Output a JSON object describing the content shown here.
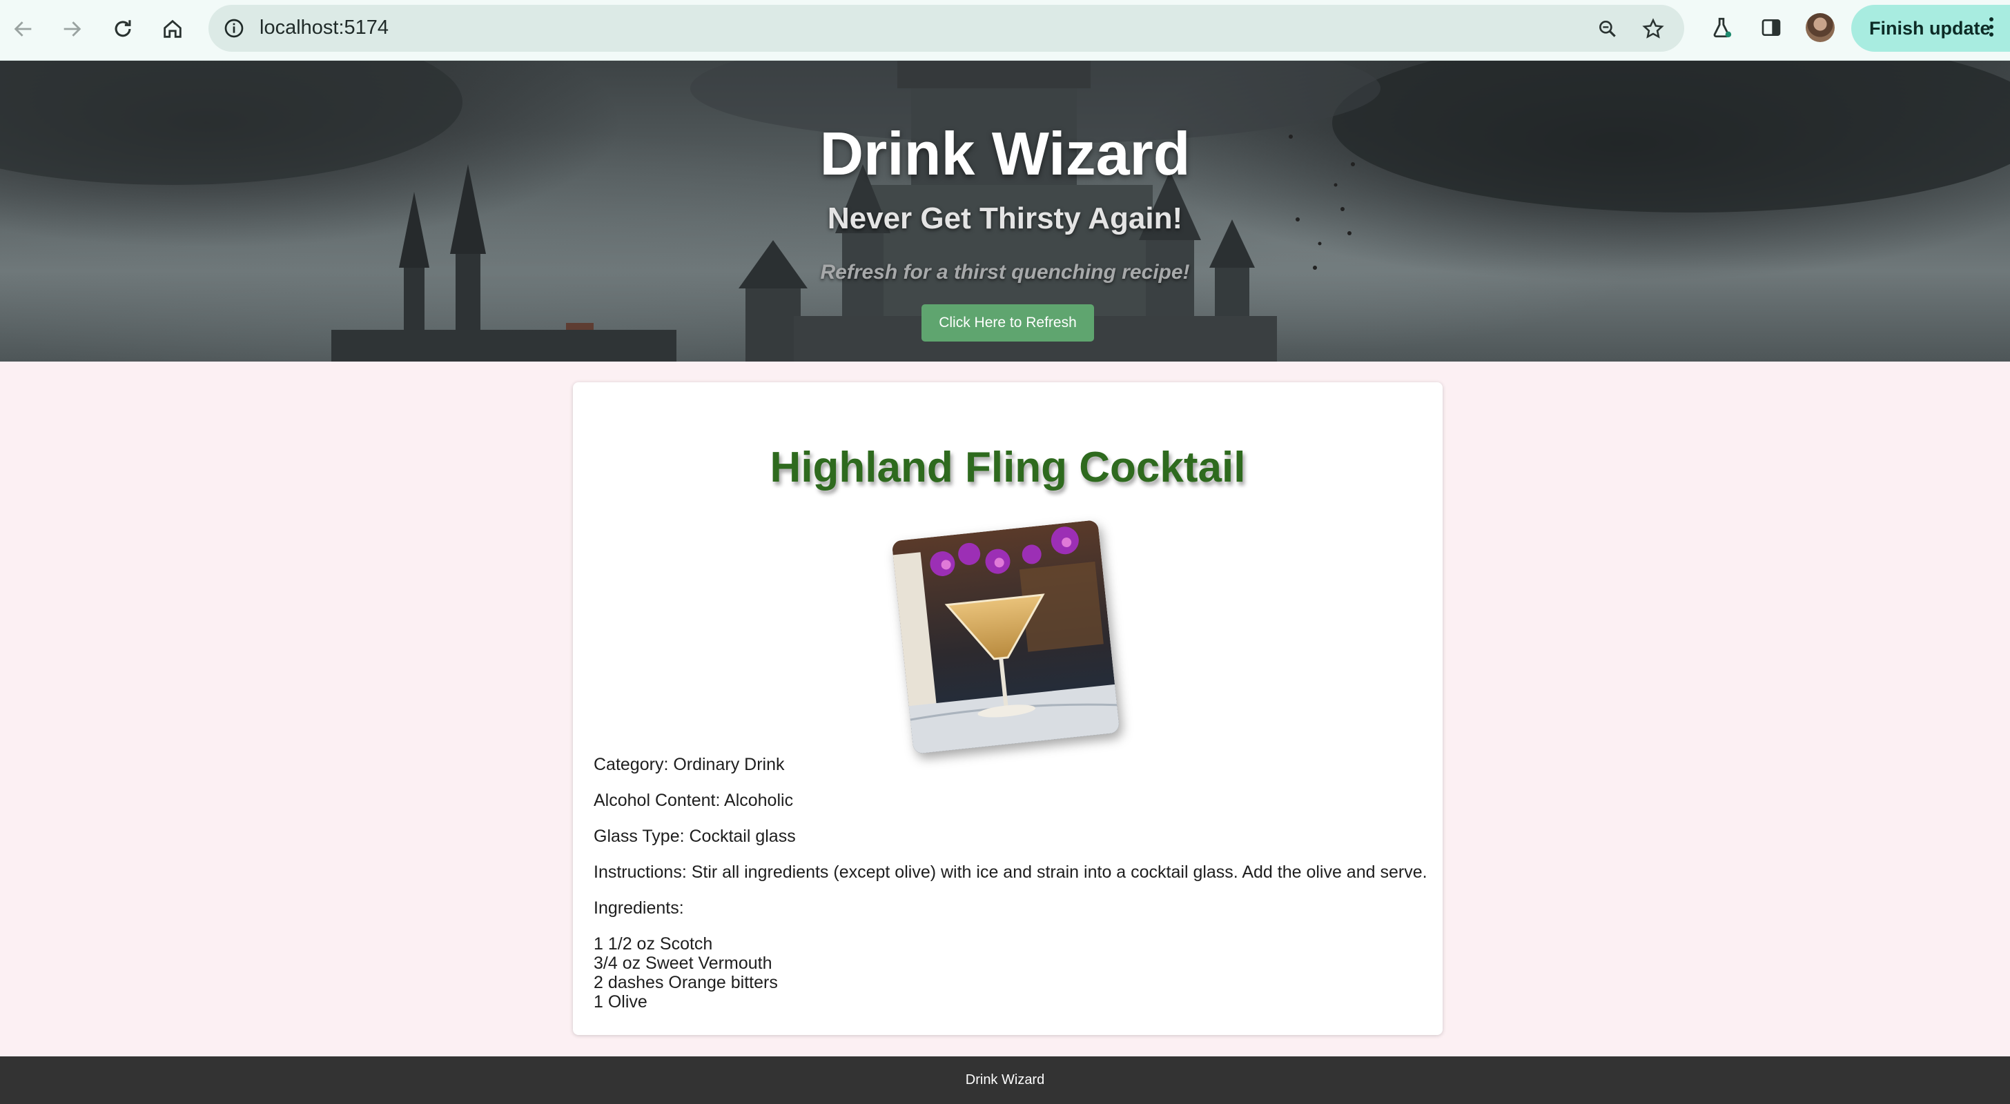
{
  "browser": {
    "url": "localhost:5174",
    "finish_update_label": "Finish update",
    "icons": [
      "back-arrow-icon",
      "forward-arrow-icon",
      "reload-icon",
      "home-icon",
      "info-icon",
      "zoom-icon",
      "star-icon",
      "labs-flask-icon",
      "side-panel-icon",
      "avatar",
      "kebab-menu-icon"
    ]
  },
  "hero": {
    "title": "Drink Wizard",
    "subtitle": "Never Get Thirsty Again!",
    "tagline": "Refresh for a thirst quenching recipe!",
    "refresh_button": "Click Here to Refresh"
  },
  "drink": {
    "name": "Highland Fling Cocktail",
    "category": "Category: Ordinary Drink",
    "alcohol": "Alcohol Content: Alcoholic",
    "glass": "Glass Type: Cocktail glass",
    "instructions": "Instructions: Stir all ingredients (except olive) with ice and strain into a cocktail glass. Add the olive and serve.",
    "ingredients_label": "Ingredients:",
    "ingredients": [
      "1 1/2 oz Scotch",
      "3/4 oz Sweet Vermouth",
      "2 dashes Orange bitters",
      "1 Olive"
    ]
  },
  "footer": {
    "text": "Drink Wizard"
  },
  "colors": {
    "page_bg": "#fcf0f3",
    "title_green": "#2e6a1e",
    "button_green": "#5fa56f",
    "footer_bg": "#333333",
    "update_button": "#a8ece0"
  }
}
